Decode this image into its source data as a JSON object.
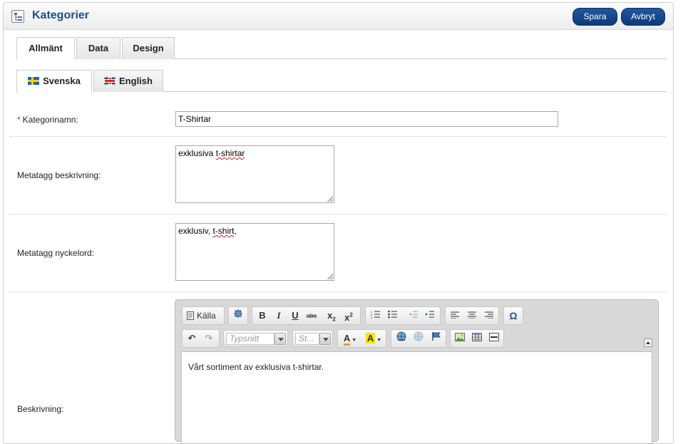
{
  "header": {
    "title": "Kategorier",
    "save_label": "Spara",
    "cancel_label": "Avbryt"
  },
  "main_tabs": [
    {
      "label": "Allmänt",
      "active": true
    },
    {
      "label": "Data",
      "active": false
    },
    {
      "label": "Design",
      "active": false
    }
  ],
  "language_tabs": [
    {
      "label": "Svenska",
      "flag": "sweden-flag",
      "active": true
    },
    {
      "label": "English",
      "flag": "uk-flag",
      "active": false
    }
  ],
  "form": {
    "required_mark": "*",
    "category_name": {
      "label": "Kategorinamn:",
      "value": "T-Shirtar"
    },
    "meta_description": {
      "label": "Metatagg beskrivning:",
      "value_plain": "exklusiva ",
      "value_spell": "t-shirtar"
    },
    "meta_keywords": {
      "label": "Metatagg nyckelord:",
      "value_plain": "exklusiv, ",
      "value_spell": "t-shirt",
      "value_tail": ","
    },
    "description": {
      "label": "Beskrivning:",
      "content": "Vårt sortiment av exklusiva t-shirtar."
    }
  },
  "editor": {
    "source_label": "Källa",
    "font_placeholder": "Typsnitt",
    "style_placeholder": "St...",
    "colors": {
      "accent": "#1b4f8f",
      "button": "#0d3a78",
      "required": "#d02020"
    }
  }
}
